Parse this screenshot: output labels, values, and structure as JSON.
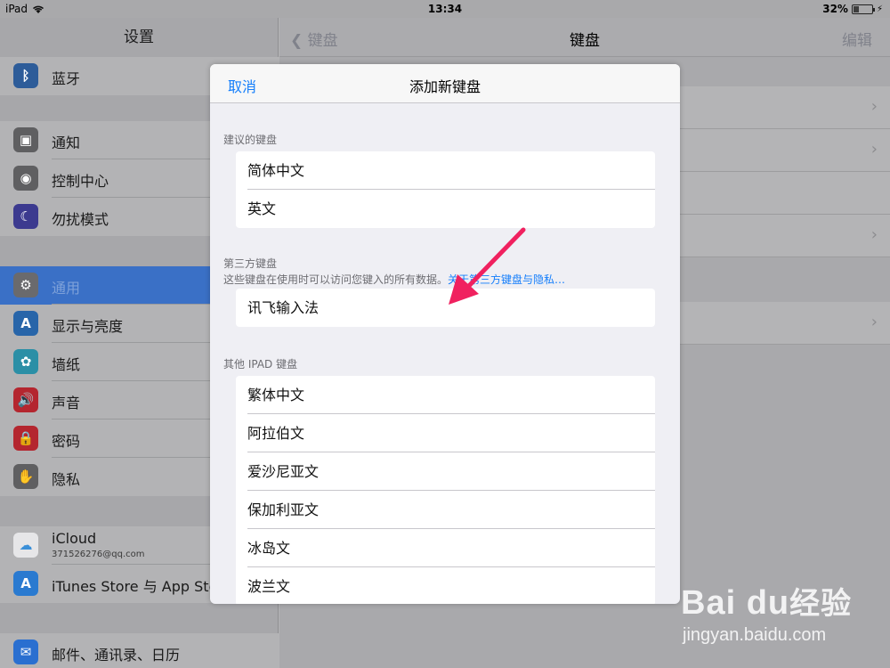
{
  "status_bar": {
    "device": "iPad",
    "time": "13:34",
    "battery": "32%",
    "battery_level": 0.32
  },
  "sidebar": {
    "title": "设置",
    "items": [
      {
        "label": "蓝牙",
        "icon": "bluetooth-icon",
        "color": "#2d5c99"
      },
      {
        "label": "通知",
        "icon": "notifications-icon",
        "color": "#5f5f61"
      },
      {
        "label": "控制中心",
        "icon": "control-center-icon",
        "color": "#5f5f61"
      },
      {
        "label": "勿扰模式",
        "icon": "moon-icon",
        "color": "#3c3a8f"
      },
      {
        "label": "通用",
        "icon": "gear-icon",
        "color": "#6a6a6d",
        "selected": true
      },
      {
        "label": "显示与亮度",
        "icon": "display-icon",
        "color": "#2865a9"
      },
      {
        "label": "墙纸",
        "icon": "wallpaper-icon",
        "color": "#2b8fa6"
      },
      {
        "label": "声音",
        "icon": "sound-icon",
        "color": "#b4262f"
      },
      {
        "label": "密码",
        "icon": "lock-icon",
        "color": "#b4262f"
      },
      {
        "label": "隐私",
        "icon": "hand-icon",
        "color": "#5f5f61"
      },
      {
        "label": "iCloud",
        "sub": "371526276@qq.com",
        "icon": "icloud-icon",
        "color": "#e6e6e8"
      },
      {
        "label": "iTunes Store 与 App Sto",
        "icon": "app-store-icon",
        "color": "#2a7ad0"
      },
      {
        "label": "邮件、通讯录、日历",
        "icon": "mail-icon",
        "color": "#2a6fd0"
      }
    ]
  },
  "detail": {
    "back_label": "键盘",
    "title": "键盘",
    "edit_label": "编辑"
  },
  "modal": {
    "cancel_label": "取消",
    "title": "添加新键盘",
    "suggested": {
      "header": "建议的键盘",
      "items": [
        "简体中文",
        "英文"
      ]
    },
    "third_party": {
      "header": "第三方键盘",
      "note": "这些键盘在使用时可以访问您键入的所有数据。",
      "link": "关于第三方键盘与隐私…",
      "items": [
        "讯飞输入法"
      ]
    },
    "other": {
      "header": "其他 IPAD 键盘",
      "items": [
        "繁体中文",
        "阿拉伯文",
        "爱沙尼亚文",
        "保加利亚文",
        "冰岛文",
        "波兰文"
      ]
    }
  },
  "watermark": {
    "brand": "Bai du",
    "brand_cn": "经验",
    "url": "jingyan.baidu.com"
  }
}
